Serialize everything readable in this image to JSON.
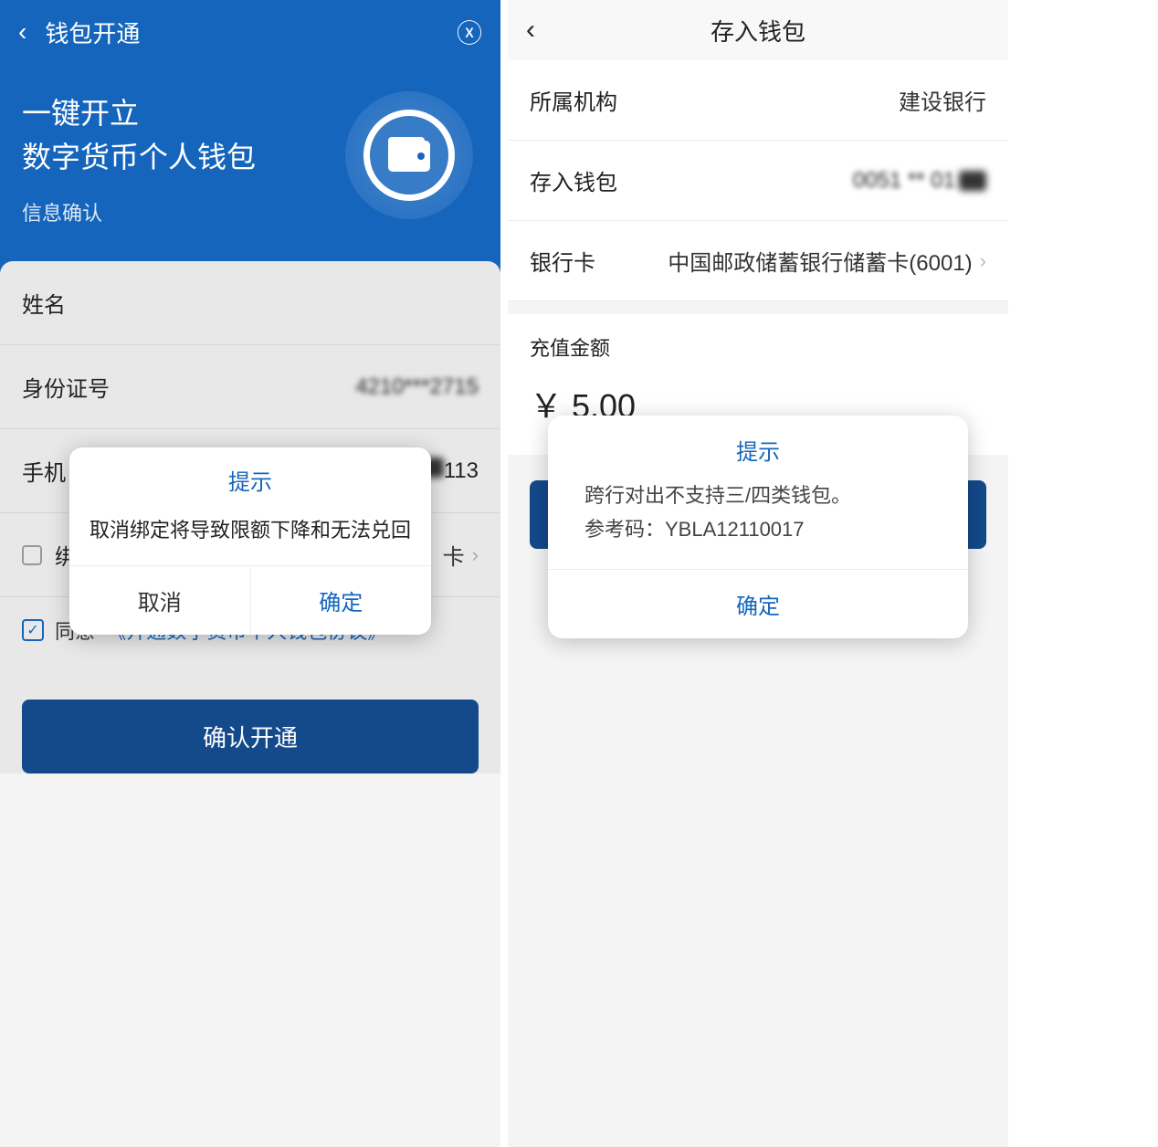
{
  "left": {
    "header": {
      "title": "钱包开通"
    },
    "hero": {
      "line1": "一键开立",
      "line2": "数字货币个人钱包",
      "sub": "信息确认"
    },
    "form": {
      "name_label": "姓名",
      "id_label": "身份证号",
      "id_value": "4210***2715",
      "phone_label": "手机",
      "phone_value_suffix": "113",
      "bind_label": "绑",
      "bind_suffix": "卡",
      "agree_label": "同意",
      "agreement_link": "《开通数字货币个人钱包协议》"
    },
    "confirm_button": "确认开通",
    "dialog": {
      "title": "提示",
      "message": "取消绑定将导致限额下降和无法兑回",
      "cancel": "取消",
      "ok": "确定"
    }
  },
  "right": {
    "header": {
      "title": "存入钱包"
    },
    "rows": {
      "org_label": "所属机构",
      "org_value": "建设银行",
      "wallet_label": "存入钱包",
      "wallet_value": "0051 ** 01",
      "card_label": "银行卡",
      "card_value": "中国邮政储蓄银行储蓄卡(6001)"
    },
    "amount": {
      "label": "充值金额",
      "value": "￥ 5.00"
    },
    "dialog": {
      "title": "提示",
      "message_line1": "跨行对出不支持三/四类钱包。",
      "message_line2": "参考码：YBLA12110017",
      "ok": "确定"
    }
  }
}
